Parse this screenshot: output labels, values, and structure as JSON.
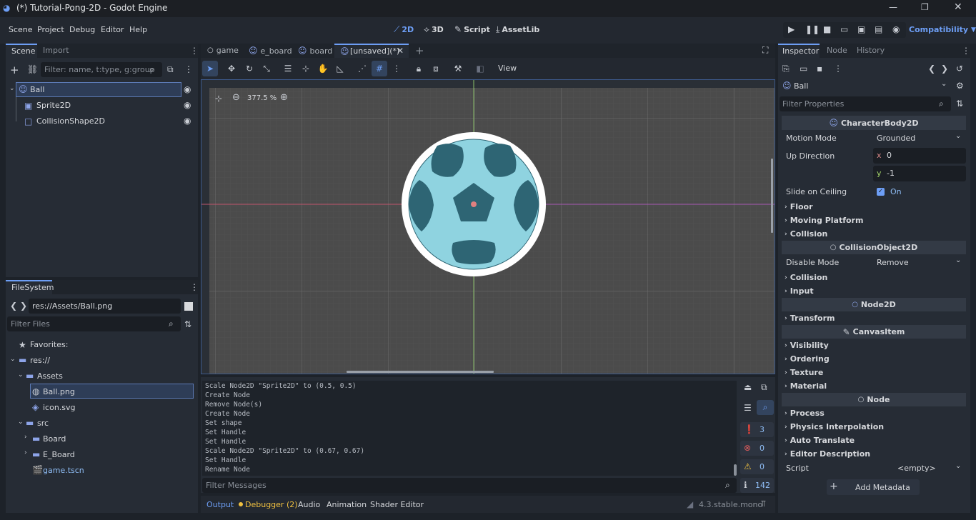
{
  "window": {
    "title": "(*) Tutorial-Pong-2D - Godot Engine"
  },
  "menu": {
    "items": [
      "Scene",
      "Project",
      "Debug",
      "Editor",
      "Help"
    ]
  },
  "workspaces": {
    "items": [
      "2D",
      "3D",
      "Script",
      "AssetLib"
    ]
  },
  "renderer": "Compatibility",
  "scene_dock": {
    "tabs": [
      "Scene",
      "Import"
    ],
    "filter_placeholder": "Filter: name, t:type, g:group",
    "tree": [
      {
        "name": "Ball",
        "type": "CharacterBody2D"
      },
      {
        "name": "Sprite2D",
        "type": "Sprite2D"
      },
      {
        "name": "CollisionShape2D",
        "type": "CollisionShape2D"
      }
    ]
  },
  "filesystem": {
    "tab": "FileSystem",
    "path": "res://Assets/Ball.png",
    "filter_placeholder": "Filter Files",
    "items": [
      {
        "label": "Favorites:"
      },
      {
        "label": "res://"
      },
      {
        "label": "Assets"
      },
      {
        "label": "Ball.png"
      },
      {
        "label": "icon.svg"
      },
      {
        "label": "src"
      },
      {
        "label": "Board"
      },
      {
        "label": "E_Board"
      },
      {
        "label": "game.tscn"
      }
    ]
  },
  "editor_tabs": [
    "game",
    "e_board",
    "board",
    "[unsaved](*)"
  ],
  "viewport": {
    "zoom": "377.5 %",
    "view_menu": "View"
  },
  "output": {
    "lines": [
      "Scale Node2D \"Sprite2D\" to (0.5, 0.5)",
      "Create Node",
      "Remove Node(s)",
      "Create Node",
      "Set shape",
      "Set Handle",
      "Set Handle",
      "Scale Node2D \"Sprite2D\" to (0.67, 0.67)",
      "Set Handle",
      "Rename Node"
    ],
    "filter_placeholder": "Filter Messages",
    "counts": {
      "messages": "3",
      "errors": "0",
      "warnings": "0",
      "editor": "142"
    }
  },
  "bottom_tabs": [
    "Output",
    "Debugger (2)",
    "Audio",
    "Animation",
    "Shader Editor"
  ],
  "version": "4.3.stable.mono",
  "inspector": {
    "tabs": [
      "Inspector",
      "Node",
      "History"
    ],
    "object": "Ball",
    "filter_placeholder": "Filter Properties",
    "cb2d": {
      "header": "CharacterBody2D",
      "motion_mode_label": "Motion Mode",
      "motion_mode": "Grounded",
      "up_direction_label": "Up Direction",
      "x_label": "x",
      "x": "0",
      "y_label": "y",
      "y": "-1",
      "slide_label": "Slide on Ceiling",
      "slide_value": "On",
      "groups": [
        "Floor",
        "Moving Platform",
        "Collision"
      ]
    },
    "co2d": {
      "header": "CollisionObject2D",
      "disable_mode_label": "Disable Mode",
      "disable_mode": "Remove",
      "groups": [
        "Collision",
        "Input"
      ]
    },
    "node2d": {
      "header": "Node2D",
      "groups": [
        "Transform"
      ]
    },
    "canvasitem": {
      "header": "CanvasItem",
      "groups": [
        "Visibility",
        "Ordering",
        "Texture",
        "Material"
      ]
    },
    "node": {
      "header": "Node",
      "groups": [
        "Process",
        "Physics Interpolation",
        "Auto Translate",
        "Editor Description"
      ],
      "script_label": "Script",
      "script_value": "<empty>"
    },
    "add_metadata": "Add Metadata"
  },
  "colors": {
    "accent": "#6d9ef5",
    "selection": "#2e3d57",
    "viewport_bg": "#4b4b4b",
    "ball_light": "#8fd3e0",
    "ball_dark": "#2e6574"
  }
}
